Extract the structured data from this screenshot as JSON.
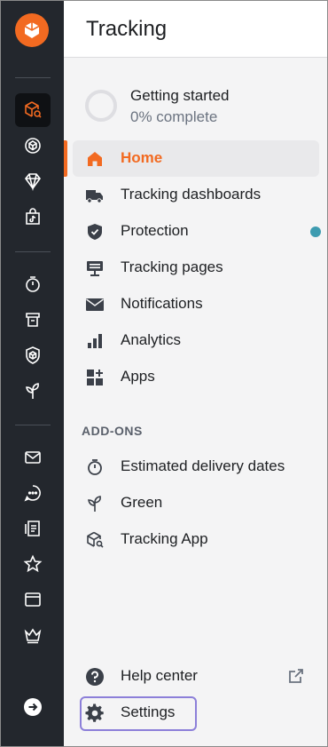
{
  "panel": {
    "title": "Tracking"
  },
  "getting_started": {
    "title": "Getting started",
    "progress_text": "0% complete",
    "progress": 0
  },
  "nav": {
    "items": [
      {
        "label": "Home",
        "icon": "home-icon",
        "active": true
      },
      {
        "label": "Tracking dashboards",
        "icon": "truck-icon"
      },
      {
        "label": "Protection",
        "icon": "shield-check-icon",
        "badge": "notification-dot"
      },
      {
        "label": "Tracking pages",
        "icon": "tracking-page-icon"
      },
      {
        "label": "Notifications",
        "icon": "envelope-icon"
      },
      {
        "label": "Analytics",
        "icon": "bar-chart-icon"
      },
      {
        "label": "Apps",
        "icon": "apps-grid-icon"
      }
    ]
  },
  "addons": {
    "section_label": "ADD-ONS",
    "items": [
      {
        "label": "Estimated delivery dates",
        "icon": "stopwatch-icon"
      },
      {
        "label": "Green",
        "icon": "sprout-icon"
      },
      {
        "label": "Tracking App",
        "icon": "box-search-icon"
      }
    ]
  },
  "bottom": {
    "help": {
      "label": "Help center",
      "icon": "question-circle-icon",
      "trailing_icon": "external-link-icon"
    },
    "settings": {
      "label": "Settings",
      "icon": "gear-icon"
    }
  },
  "rail": {
    "icons": [
      "logo-icon",
      "box-search-icon",
      "cube-icon",
      "diamond-icon",
      "tiktok-bag-icon",
      "stopwatch-icon",
      "returns-icon",
      "shield-box-icon",
      "sprout-icon",
      "envelope-icon",
      "chat-icon",
      "receipt-icon",
      "star-icon",
      "browser-icon",
      "crown-icon",
      "arrow-right-circle-icon"
    ]
  },
  "colors": {
    "accent": "#f26a21",
    "rail_bg": "#23272d",
    "panel_bg": "#f4f4f5",
    "badge": "#3d9bb0",
    "focus": "#8c7fd9"
  }
}
